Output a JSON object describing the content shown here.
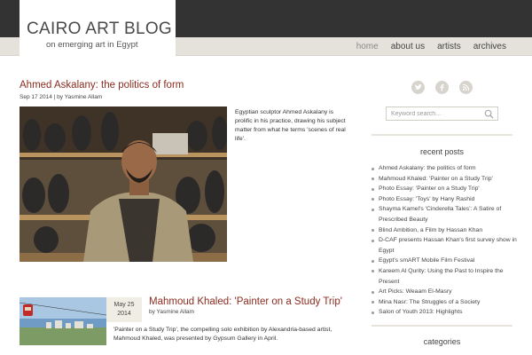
{
  "site": {
    "title": "CAIRO ART BLOG",
    "tagline": "on emerging art in Egypt"
  },
  "nav": {
    "items": [
      {
        "label": "home",
        "active": true
      },
      {
        "label": "about us",
        "active": false
      },
      {
        "label": "artists",
        "active": false
      },
      {
        "label": "archives",
        "active": false
      }
    ]
  },
  "posts": [
    {
      "title": "Ahmed Askalany: the politics of form",
      "meta": "Sep 17 2014 | by Yasmine Allam",
      "excerpt": "Egyptian sculptor Ahmed Askalany is prolific in his practice, drawing his subject matter from what he terms 'scenes of real life'."
    },
    {
      "title": "Mahmoud Khaled: 'Painter on a Study Trip'",
      "date_month_day": "May 25",
      "date_year": "2014",
      "meta": "by Yasmine Allam",
      "excerpt": "'Painter on a Study Trip', the compelling solo exhibition by Alexandria-based artist, Mahmoud Khaled, was presented by Gypsum Gallery in April."
    }
  ],
  "sidebar": {
    "social_icons": [
      "twitter-icon",
      "facebook-icon",
      "rss-icon"
    ],
    "search_placeholder": "Keyword search...",
    "recent_title": "recent posts",
    "recent_posts": [
      "Ahmed Askalany: the politics of form",
      "Mahmoud Khaled: 'Painter on a Study Trip'",
      "Photo Essay: 'Painter on a Study Trip'",
      "Photo Essay: 'Toys' by Hany Rashid",
      "Shayma Kamel's 'Cinderella Tales': A Satire of Prescribed Beauty",
      "Blind Ambition, a Film by Hassan Khan",
      "D-CAF presents Hassan Khan's first survey show in Egypt",
      "Egypt's smART Mobile Film Festival",
      "Kareem Al Qurity: Using the Past to Inspire the Present",
      "Art Picks: Weaam El-Masry",
      "Mina Nasr: The Struggles of a Society",
      "Salon of Youth 2013: Highlights"
    ],
    "categories_title": "categories"
  },
  "colors": {
    "accent": "#8b2c1f",
    "topbar": "#333333",
    "navbar": "#e4e2da"
  }
}
